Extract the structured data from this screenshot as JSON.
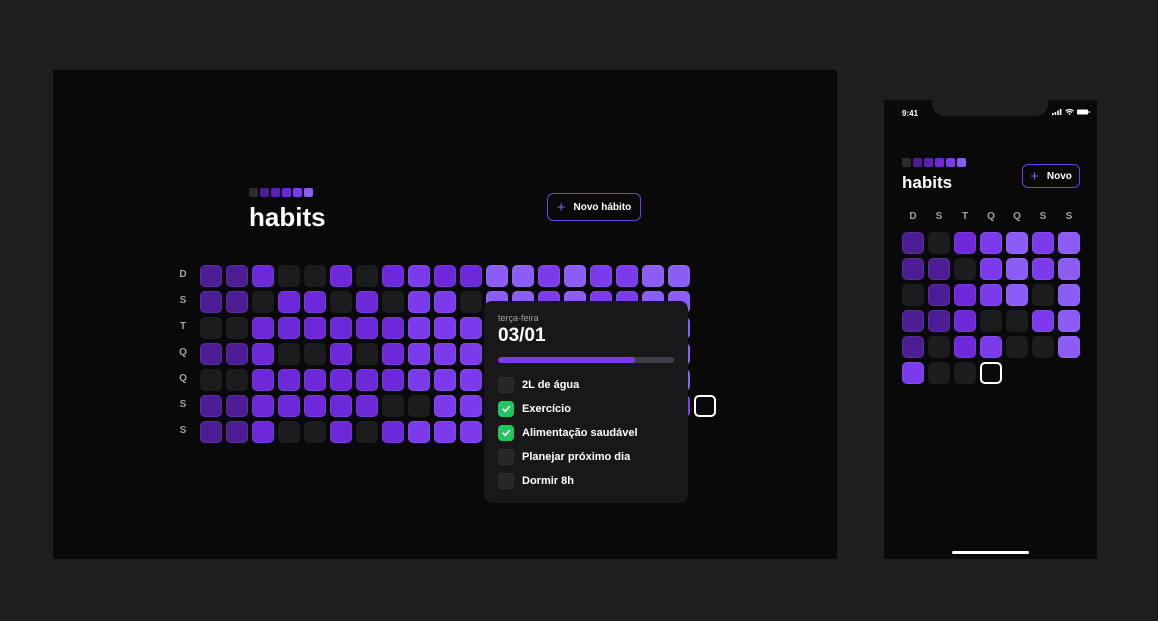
{
  "desktop": {
    "app_title": "habits",
    "new_button_label": "Novo hábito",
    "plus_glyph": "+",
    "weekday_labels": [
      "D",
      "S",
      "T",
      "Q",
      "Q",
      "S",
      "S"
    ],
    "logo_colors": [
      "#2b2b30",
      "#4c1d95",
      "#5b21b6",
      "#6d28d9",
      "#7c3aed",
      "#8b5cf6"
    ],
    "grid_levels": [
      [
        1,
        1,
        2,
        0,
        0,
        2,
        0,
        2,
        3,
        2,
        2,
        4,
        4,
        3,
        4,
        3,
        3,
        4,
        4
      ],
      [
        1,
        1,
        0,
        2,
        2,
        0,
        2,
        0,
        3,
        3,
        0,
        4,
        4,
        3,
        4,
        3,
        3,
        4,
        4
      ],
      [
        0,
        0,
        2,
        2,
        2,
        2,
        2,
        2,
        3,
        3,
        3,
        3,
        3,
        3,
        3,
        3,
        4,
        4,
        4
      ],
      [
        1,
        1,
        2,
        0,
        0,
        2,
        0,
        2,
        3,
        3,
        3,
        3,
        3,
        3,
        3,
        3,
        4,
        4,
        4
      ],
      [
        0,
        0,
        2,
        2,
        2,
        2,
        2,
        2,
        3,
        3,
        3,
        3,
        3,
        3,
        3,
        3,
        4,
        4,
        4
      ],
      [
        1,
        1,
        2,
        2,
        2,
        2,
        2,
        0,
        0,
        3,
        3,
        3,
        3,
        3,
        3,
        3,
        3,
        3,
        3
      ],
      [
        1,
        1,
        2,
        0,
        0,
        2,
        0,
        2,
        3,
        3,
        3,
        3,
        3,
        3,
        3,
        3,
        3,
        3
      ]
    ],
    "palette": {
      "0": "#1c1c1f",
      "1": "#4c1d95",
      "2": "#6d28d9",
      "3": "#7c3aed",
      "4": "#8b5cf6"
    },
    "popover": {
      "weekday": "terça-feira",
      "date": "03/01",
      "progress": 0.78,
      "habits": [
        {
          "label": "2L de água",
          "checked": false
        },
        {
          "label": "Exercício",
          "checked": true
        },
        {
          "label": "Alimentação saudável",
          "checked": true
        },
        {
          "label": "Planejar próximo dia",
          "checked": false
        },
        {
          "label": "Dormir 8h",
          "checked": false
        }
      ]
    }
  },
  "mobile": {
    "status_time": "9:41",
    "app_title": "habits",
    "new_button_label": "Novo",
    "plus_glyph": "+",
    "week_header": [
      "D",
      "S",
      "T",
      "Q",
      "Q",
      "S",
      "S"
    ],
    "logo_colors": [
      "#2b2b30",
      "#4c1d95",
      "#5b21b6",
      "#6d28d9",
      "#7c3aed",
      "#8b5cf6"
    ],
    "grid_levels": [
      [
        1,
        0,
        2,
        3,
        4,
        3,
        4
      ],
      [
        1,
        1,
        0,
        3,
        4,
        3,
        4
      ],
      [
        0,
        1,
        2,
        3,
        4,
        0,
        4
      ],
      [
        1,
        1,
        2,
        0,
        0,
        3,
        4
      ],
      [
        1,
        0,
        2,
        3,
        0,
        0,
        4
      ],
      [
        3,
        0,
        0,
        "today"
      ]
    ]
  }
}
